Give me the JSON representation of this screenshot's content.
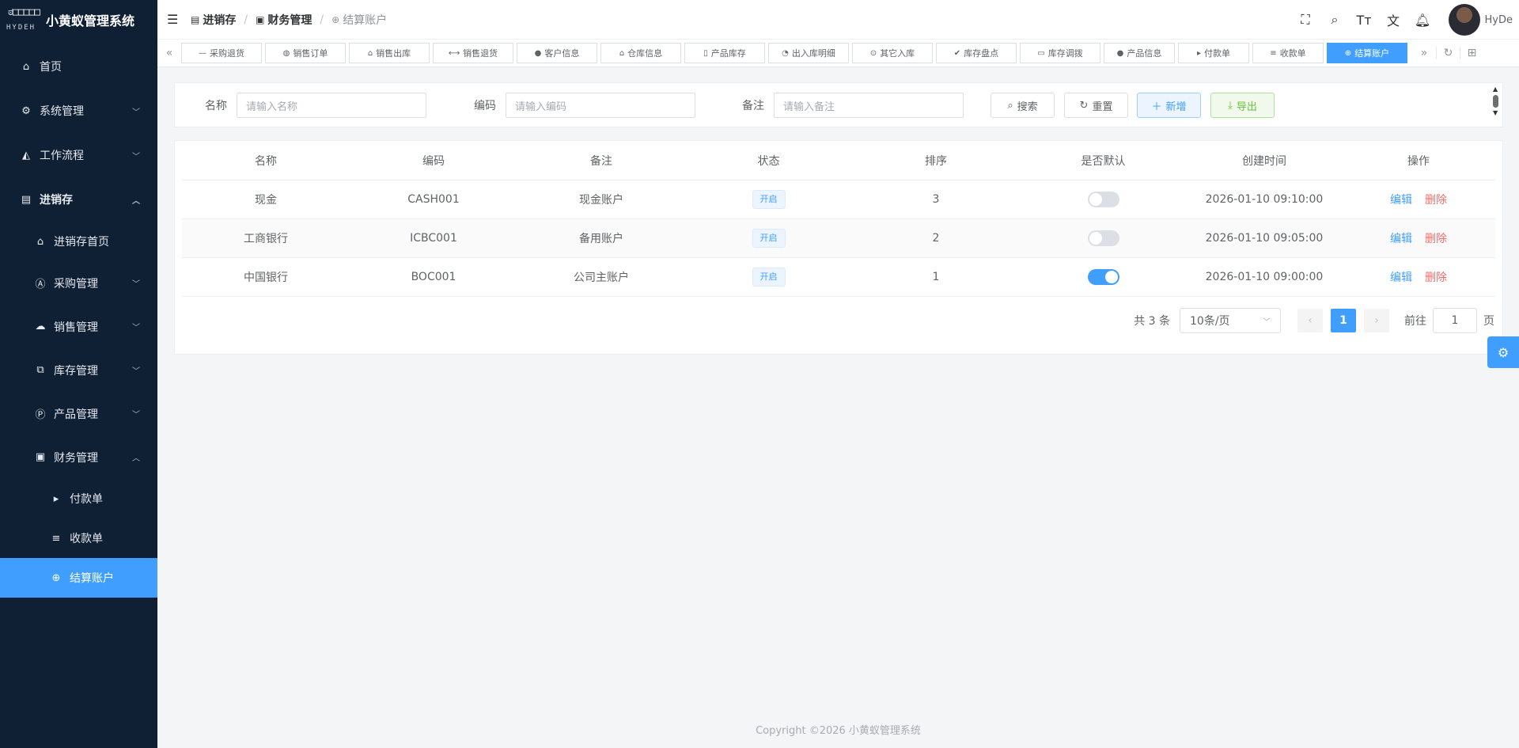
{
  "app": {
    "logo_glyph": "ಠ□□□□□",
    "logo_brand": "HYDEH",
    "title": "小黄蚁管理系统"
  },
  "sidebar": {
    "items": [
      {
        "label": "首页",
        "icon": "home-icon"
      },
      {
        "label": "系统管理",
        "icon": "gear-icon"
      },
      {
        "label": "工作流程",
        "icon": "flow-icon"
      },
      {
        "label": "进销存",
        "icon": "ledger-icon"
      },
      {
        "label": "进销存首页",
        "icon": "home-icon"
      },
      {
        "label": "采购管理",
        "icon": "purchase-icon"
      },
      {
        "label": "销售管理",
        "icon": "cloud-icon"
      },
      {
        "label": "库存管理",
        "icon": "stock-icon"
      },
      {
        "label": "产品管理",
        "icon": "product-icon"
      },
      {
        "label": "财务管理",
        "icon": "finance-icon"
      },
      {
        "label": "付款单",
        "icon": "caret-right-icon"
      },
      {
        "label": "收款单",
        "icon": "list-icon"
      },
      {
        "label": "结算账户",
        "icon": "account-icon"
      }
    ]
  },
  "breadcrumb": [
    "进销存",
    "财务管理",
    "结算账户"
  ],
  "header": {
    "username": "HyDe"
  },
  "tabs": [
    {
      "label": "采购退货",
      "icon": "minus-icon"
    },
    {
      "label": "销售订单",
      "icon": "globe-icon"
    },
    {
      "label": "销售出库",
      "icon": "bag-icon"
    },
    {
      "label": "销售退货",
      "icon": "barbell-icon"
    },
    {
      "label": "客户信息",
      "icon": "user-icon"
    },
    {
      "label": "仓库信息",
      "icon": "house-icon"
    },
    {
      "label": "产品库存",
      "icon": "trash-icon"
    },
    {
      "label": "出入库明细",
      "icon": "signal-icon"
    },
    {
      "label": "其它入库",
      "icon": "zoom-icon"
    },
    {
      "label": "库存盘点",
      "icon": "check-icon"
    },
    {
      "label": "库存调拨",
      "icon": "folder-icon"
    },
    {
      "label": "产品信息",
      "icon": "apple-icon"
    },
    {
      "label": "付款单",
      "icon": "caret-right-icon"
    },
    {
      "label": "收款单",
      "icon": "list-icon"
    },
    {
      "label": "结算账户",
      "icon": "account-icon"
    }
  ],
  "search": {
    "name_label": "名称",
    "name_placeholder": "请输入名称",
    "code_label": "编码",
    "code_placeholder": "请输入编码",
    "remark_label": "备注",
    "remark_placeholder": "请输入备注",
    "search_btn": "搜索",
    "reset_btn": "重置",
    "add_btn": "新增",
    "export_btn": "导出"
  },
  "table": {
    "columns": [
      "名称",
      "编码",
      "备注",
      "状态",
      "排序",
      "是否默认",
      "创建时间",
      "操作"
    ],
    "rows": [
      {
        "name": "现金",
        "code": "CASH001",
        "remark": "现金账户",
        "status": "开启",
        "sort": "3",
        "default": false,
        "created": "2026-01-10 09:10:00"
      },
      {
        "name": "工商银行",
        "code": "ICBC001",
        "remark": "备用账户",
        "status": "开启",
        "sort": "2",
        "default": false,
        "created": "2026-01-10 09:05:00"
      },
      {
        "name": "中国银行",
        "code": "BOC001",
        "remark": "公司主账户",
        "status": "开启",
        "sort": "1",
        "default": true,
        "created": "2026-01-10 09:00:00"
      }
    ],
    "edit_label": "编辑",
    "delete_label": "删除"
  },
  "pagination": {
    "total": "共 3 条",
    "page_size": "10条/页",
    "current": "1",
    "goto_prefix": "前往",
    "goto_value": "1",
    "goto_suffix": "页"
  },
  "footer": "Copyright ©2026 小黄蚁管理系统",
  "colors": {
    "primary": "#409eff",
    "sidebar": "#0f1f34",
    "danger": "#f56c6c",
    "success": "#67c23a"
  }
}
